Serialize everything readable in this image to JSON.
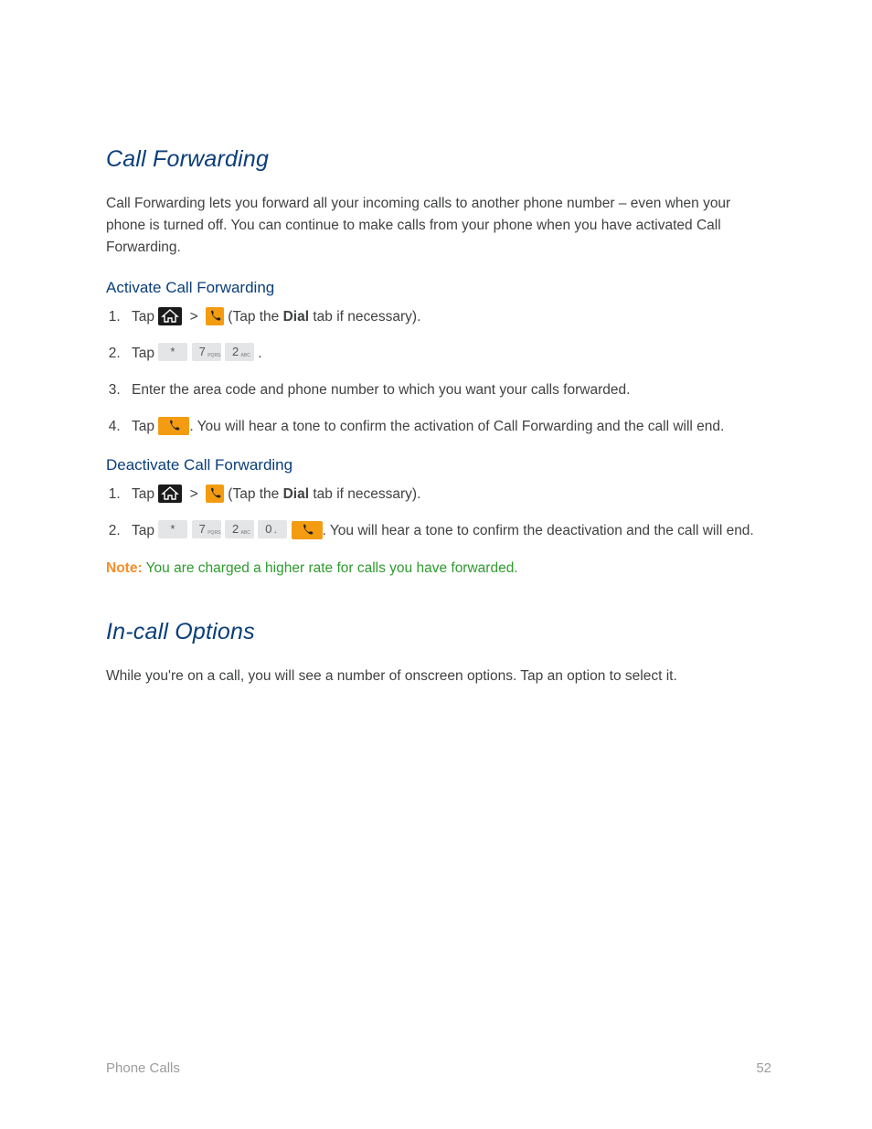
{
  "sections": {
    "callForwarding": {
      "heading": "Call Forwarding",
      "intro": "Call Forwarding lets you forward all your incoming calls to another phone number – even when your phone is turned off. You can continue to make calls from your phone when you have activated Call Forwarding.",
      "activate": {
        "heading": "Activate Call Forwarding",
        "steps": {
          "s1_pre": "Tap ",
          "s1_post_a": " > ",
          "s1_post_b": " (Tap the ",
          "s1_bold": "Dial",
          "s1_tail": " tab if necessary).",
          "s2_pre": "Tap ",
          "s2_tail": " .",
          "s3": "Enter the area code and phone number to which you want your calls forwarded.",
          "s4_pre": "Tap ",
          "s4_tail": ". You will hear a tone to confirm the activation of Call Forwarding and the call will end."
        }
      },
      "deactivate": {
        "heading": "Deactivate Call Forwarding",
        "steps": {
          "s1_pre": "Tap ",
          "s1_post_a": " > ",
          "s1_post_b": " (Tap the ",
          "s1_bold": "Dial",
          "s1_tail": " tab if necessary).",
          "s2_pre": "Tap ",
          "s2_tail": ". You will hear a tone to confirm the deactivation and the call will end."
        }
      },
      "note": {
        "label": "Note:",
        "text": " You are charged a higher rate for calls you have forwarded."
      }
    },
    "inCallOptions": {
      "heading": "In-call Options",
      "intro": "While you're on a call, you will see a number of onscreen options. Tap an option to select it."
    }
  },
  "keys": {
    "star": {
      "glyph": "*",
      "sup": ""
    },
    "seven": {
      "glyph": "7",
      "sup": "PQRS"
    },
    "two": {
      "glyph": "2",
      "sup": "ABC"
    },
    "zero": {
      "glyph": "0",
      "sup": "+"
    }
  },
  "footer": {
    "section": "Phone Calls",
    "page": "52"
  }
}
